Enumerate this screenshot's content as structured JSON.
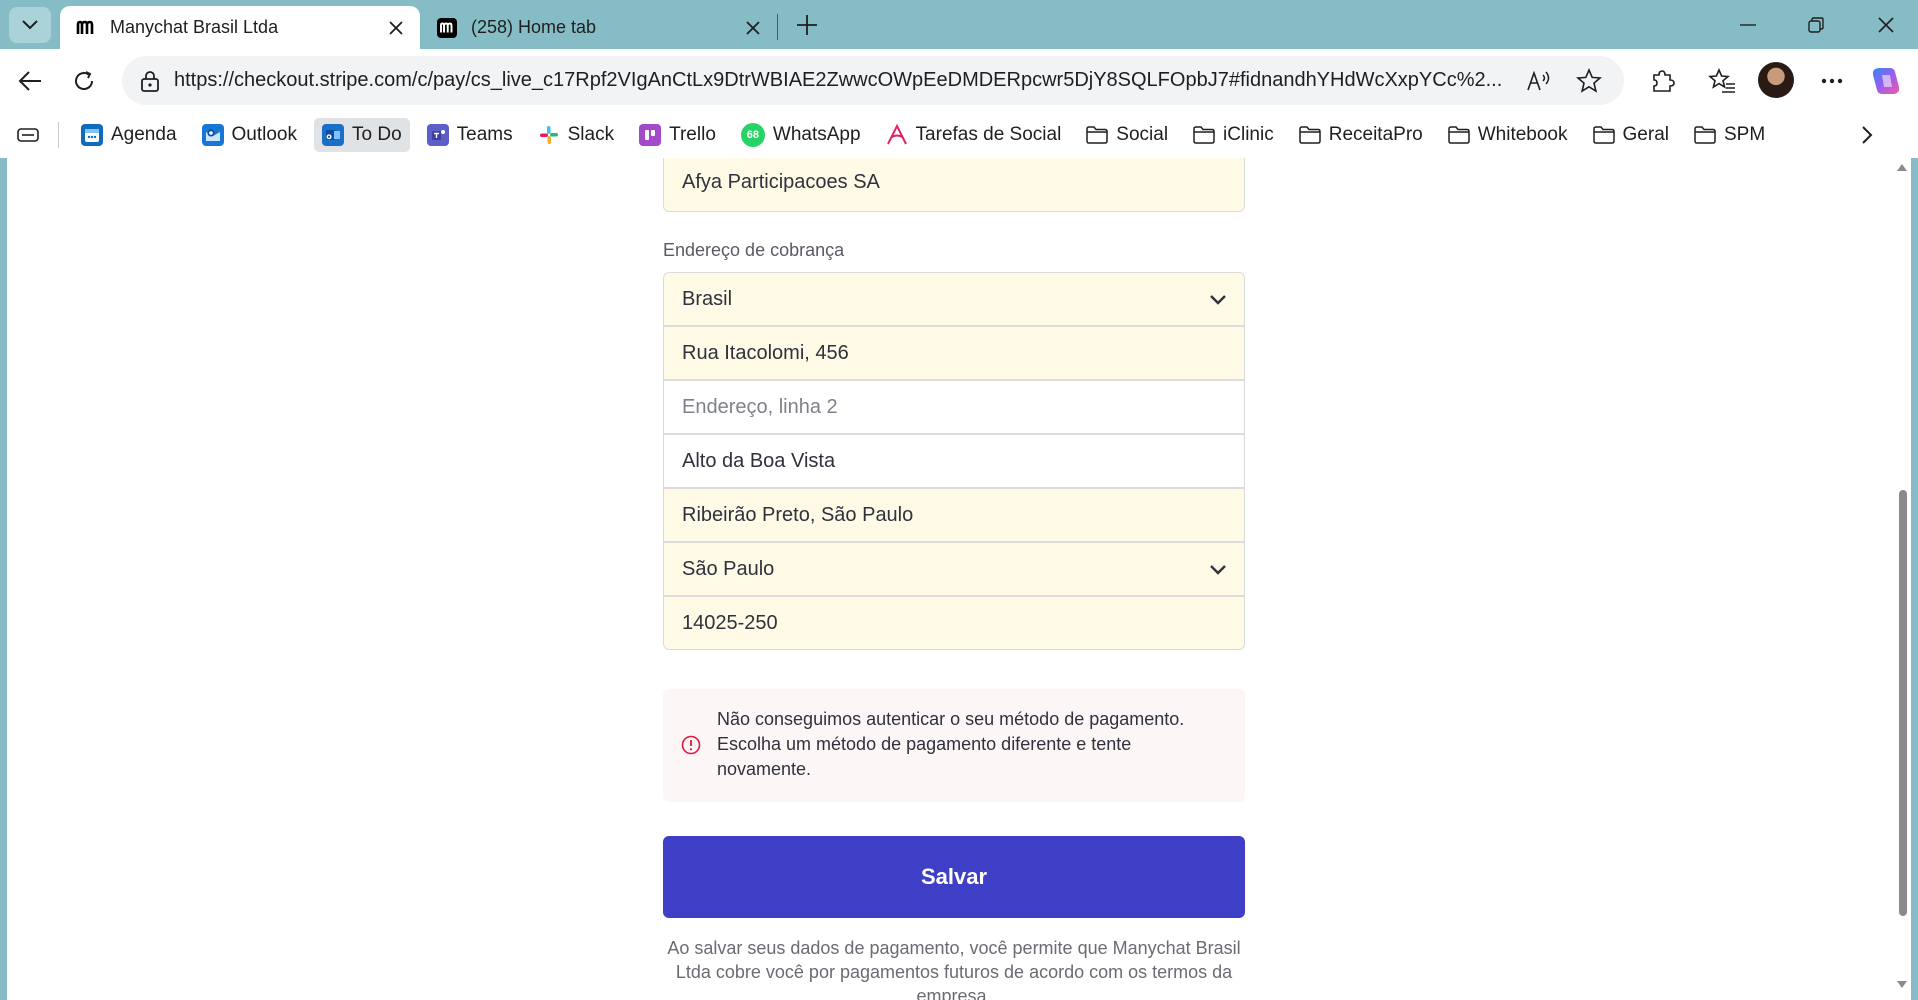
{
  "browser": {
    "tabs": [
      {
        "title": "Manychat Brasil Ltda",
        "favicon": "manychat-logo-icon"
      },
      {
        "title": "(258) Home tab",
        "favicon": "manychat-logo-icon"
      }
    ],
    "url": "https://checkout.stripe.com/c/pay/cs_live_c17Rpf2VIgAnCtLx9DtrWBIAE2ZwwcOWpEeDMDERpcwr5DjY8SQLFOpbJ7#fidnandhYHdWcXxpYCc%2..."
  },
  "bookmarks": [
    {
      "label": "Agenda",
      "icon": "calendar-icon",
      "color": "#0f6cbd"
    },
    {
      "label": "Outlook",
      "icon": "outlook-icon",
      "color": "#1877d4"
    },
    {
      "label": "To Do",
      "icon": "outlook-todo-icon",
      "color": "#1a6fc9"
    },
    {
      "label": "Teams",
      "icon": "teams-icon",
      "color": "#5b5fc7"
    },
    {
      "label": "Slack",
      "icon": "slack-icon",
      "color": "#e01e5a"
    },
    {
      "label": "Trello",
      "icon": "trello-icon",
      "color": "#a349c9"
    },
    {
      "label": "WhatsApp",
      "icon": "whatsapp-icon",
      "color": "#25d366",
      "badge": "68"
    },
    {
      "label": "Tarefas de Social",
      "icon": "asana-icon",
      "color": "#e0245e"
    },
    {
      "label": "Social",
      "icon": "folder-icon"
    },
    {
      "label": "iClinic",
      "icon": "folder-icon"
    },
    {
      "label": "ReceitaPro",
      "icon": "folder-icon"
    },
    {
      "label": "Whitebook",
      "icon": "folder-icon"
    },
    {
      "label": "Geral",
      "icon": "folder-icon"
    },
    {
      "label": "SPM",
      "icon": "folder-icon"
    }
  ],
  "form": {
    "company_name": "Afya Participacoes SA",
    "billing_label": "Endereço de cobrança",
    "country": "Brasil",
    "address_line1": "Rua Itacolomi, 456",
    "address_line2_placeholder": "Endereço, linha 2",
    "neighborhood": "Alto da Boa Vista",
    "city": "Ribeirão Preto, São Paulo",
    "state": "São Paulo",
    "postal_code": "14025-250",
    "error_message": "Não conseguimos autenticar o seu método de pagamento. Escolha um método de pagamento diferente e tente novamente.",
    "save_label": "Salvar",
    "legal_text": "Ao salvar seus dados de pagamento, você permite que Manychat Brasil Ltda cobre você por pagamentos futuros de acordo com os termos da empresa."
  },
  "colors": {
    "accent": "#3e3ec6",
    "autofill": "#fffae6",
    "error": "#df1b41"
  }
}
